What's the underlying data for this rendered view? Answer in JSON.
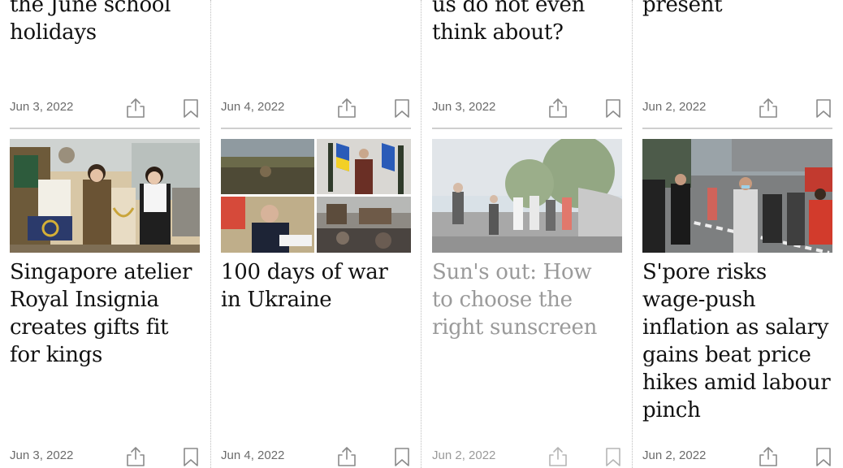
{
  "top_row": [
    {
      "headline": "the June school holidays",
      "date": "Jun 3, 2022"
    },
    {
      "headline": "",
      "date": "Jun 4, 2022"
    },
    {
      "headline": "us do not even think about?",
      "date": "Jun 3, 2022"
    },
    {
      "headline": "present",
      "date": "Jun 2, 2022"
    }
  ],
  "cards": [
    {
      "headline": "Singapore atelier Royal Insignia creates gifts fit for kings",
      "date": "Jun 3, 2022",
      "image": "jewellery-atelier-photo"
    },
    {
      "headline": "100 days of war in Ukraine",
      "date": "Jun 4, 2022",
      "image": "ukraine-war-collage-photo"
    },
    {
      "headline": "Sun's out: How to choose the right sunscreen",
      "date": "Jun 2, 2022",
      "image": "joggers-on-bridge-photo",
      "faded": true
    },
    {
      "headline": "S'pore risks wage-push inflation as salary gains beat price hikes amid labour pinch",
      "date": "Jun 2, 2022",
      "image": "masked-commuters-crossing-photo"
    }
  ],
  "icons": {
    "share": "share-icon",
    "bookmark": "bookmark-icon"
  }
}
